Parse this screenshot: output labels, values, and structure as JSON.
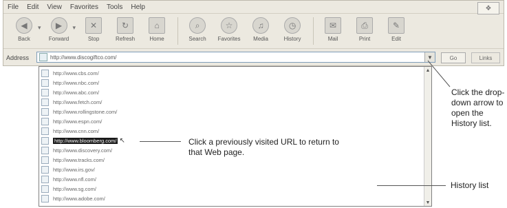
{
  "menu": [
    "File",
    "Edit",
    "View",
    "Favorites",
    "Tools",
    "Help"
  ],
  "toolbar": {
    "buttons": [
      {
        "label": "Back",
        "icon": "back-arrow-icon"
      },
      {
        "label": "Forward",
        "icon": "forward-arrow-icon"
      },
      {
        "label": "Stop",
        "icon": "stop-icon"
      },
      {
        "label": "Refresh",
        "icon": "refresh-icon"
      },
      {
        "label": "Home",
        "icon": "home-icon"
      },
      {
        "label": "Search",
        "icon": "search-icon"
      },
      {
        "label": "Favorites",
        "icon": "favorites-star-icon"
      },
      {
        "label": "Media",
        "icon": "media-icon"
      },
      {
        "label": "History",
        "icon": "history-clock-icon"
      },
      {
        "label": "Mail",
        "icon": "mail-icon"
      },
      {
        "label": "Print",
        "icon": "print-icon"
      },
      {
        "label": "Edit",
        "icon": "edit-icon"
      }
    ]
  },
  "address": {
    "label": "Address",
    "value": "http://www.discogiftco.com/",
    "go_label": "Go",
    "links_label": "Links"
  },
  "history": {
    "items": [
      "http://www.cbs.com/",
      "http://www.nbc.com/",
      "http://www.abc.com/",
      "http://www.fetch.com/",
      "http://www.rollingstone.com/",
      "http://www.espn.com/",
      "http://www.cnn.com/",
      "http://www.bloomberg.com/",
      "http://www.discovery.com/",
      "http://www.tracks.com/",
      "http://www.irs.gov/",
      "http://www.nfl.com/",
      "http://www.sg.com/",
      "http://www.adobe.com/"
    ],
    "selected_index": 7
  },
  "callouts": {
    "visited": "Click a previously visited URL to return to that Web page.",
    "dropdown": "Click the drop-down arrow to open the History list.",
    "history_list": "History list"
  },
  "colors": {
    "window": "#ece9e0",
    "selection": "#1a1a1a"
  }
}
